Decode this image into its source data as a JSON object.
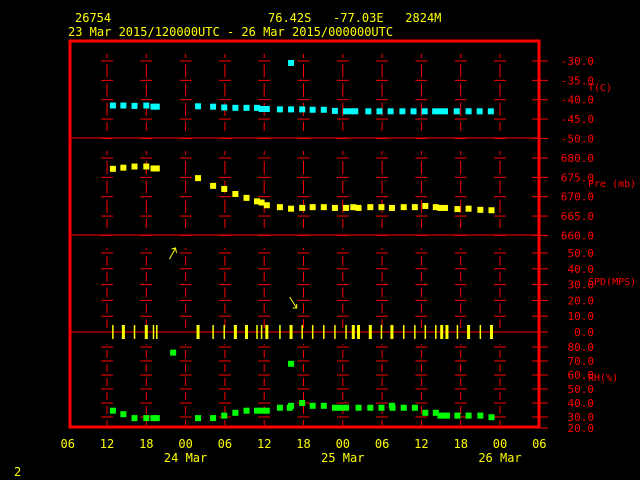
{
  "header": {
    "station_id": "26754",
    "location": "76.42S   -77.03E   2824M",
    "period": "23 Mar 2015/120000UTC - 26 Mar 2015/000000UTC"
  },
  "page_number": "2",
  "colors": {
    "axis": "#ff0000",
    "text": "#ffff00",
    "temperature": "#00ffff",
    "pressure": "#ffff00",
    "wind": "#ffff00",
    "humidity": "#00ff00"
  },
  "chart_data": {
    "type": "scatter",
    "x_unit": "hours since 23 Mar 2015 12:00 UTC",
    "xlim": [
      -6,
      66
    ],
    "x_tick_labels": [
      "06",
      "12",
      "18",
      "00",
      "06",
      "12",
      "18",
      "00",
      "06",
      "12",
      "18",
      "00",
      "06"
    ],
    "x_tick_hours": [
      -6,
      0,
      6,
      12,
      18,
      24,
      30,
      36,
      42,
      48,
      54,
      60,
      66
    ],
    "date_labels": [
      {
        "label": "24 Mar",
        "hour": 12
      },
      {
        "label": "25 Mar",
        "hour": 36
      },
      {
        "label": "26 Mar",
        "hour": 60
      }
    ],
    "panels": [
      {
        "name": "temperature",
        "ylabel": "T(C)",
        "ylim": [
          -50,
          -25
        ],
        "y_ticks": [
          -30,
          -35,
          -40,
          -45,
          -50
        ],
        "y_tick_labels": [
          "-30.0",
          "-35.0",
          "-40.0",
          "-45.0",
          "-50.0"
        ],
        "x": [
          0.9,
          2.5,
          4.2,
          6.0,
          7.1,
          7.6,
          13.9,
          16.2,
          17.9,
          19.6,
          21.3,
          22.9,
          23.6,
          24.4,
          26.4,
          28.1,
          29.8,
          31.4,
          33.1,
          34.8,
          36.5,
          37.2,
          37.9,
          39.9,
          41.6,
          43.3,
          45.1,
          46.8,
          48.5,
          50.1,
          50.9,
          51.6,
          53.4,
          55.2,
          56.9,
          58.6,
          28.1
        ],
        "y": [
          -41.5,
          -41.5,
          -41.6,
          -41.5,
          -41.8,
          -41.8,
          -41.7,
          -41.8,
          -42.0,
          -42.1,
          -42.1,
          -42.1,
          -42.4,
          -42.4,
          -42.5,
          -42.5,
          -42.5,
          -42.6,
          -42.6,
          -42.9,
          -43.0,
          -43.0,
          -43.0,
          -43.0,
          -43.0,
          -43.0,
          -43.0,
          -43.0,
          -43.0,
          -43.0,
          -43.0,
          -43.0,
          -43.0,
          -43.0,
          -43.0,
          -43.0,
          -30.5
        ]
      },
      {
        "name": "pressure",
        "ylabel": "Pre (mb)",
        "ylim": [
          660,
          685
        ],
        "y_ticks": [
          680,
          675,
          670,
          665,
          660
        ],
        "y_tick_labels": [
          "680.0",
          "675.0",
          "670.0",
          "665.0",
          "660.0"
        ],
        "x": [
          0.9,
          2.5,
          4.2,
          6.0,
          7.1,
          7.6,
          13.9,
          16.2,
          17.9,
          19.6,
          21.3,
          22.9,
          23.6,
          24.4,
          26.4,
          28.1,
          29.8,
          31.4,
          33.1,
          34.8,
          36.5,
          37.6,
          38.4,
          40.2,
          41.9,
          43.5,
          45.3,
          47.0,
          48.6,
          50.2,
          50.9,
          51.6,
          53.5,
          55.2,
          57.0,
          58.7
        ],
        "y": [
          677.2,
          677.5,
          677.8,
          677.8,
          677.3,
          677.3,
          674.8,
          672.8,
          672.0,
          670.7,
          669.7,
          668.8,
          668.5,
          667.8,
          667.3,
          666.9,
          667.1,
          667.3,
          667.3,
          667.1,
          667.1,
          667.3,
          667.1,
          667.3,
          667.3,
          667.1,
          667.3,
          667.3,
          667.6,
          667.3,
          667.1,
          667.1,
          666.8,
          666.9,
          666.6,
          666.5
        ]
      },
      {
        "name": "wind_speed",
        "ylabel": "SPD(MPS)",
        "ylim": [
          0,
          55
        ],
        "y_ticks": [
          50,
          40,
          30,
          20,
          10,
          0
        ],
        "y_tick_labels": [
          "50.0",
          "40.0",
          "30.0",
          "20.0",
          "10.0",
          "0.0"
        ],
        "x": [
          0.9,
          2.5,
          4.2,
          6.0,
          7.1,
          7.6,
          13.9,
          16.2,
          17.9,
          19.6,
          21.3,
          22.9,
          23.6,
          24.4,
          26.4,
          28.1,
          29.8,
          31.4,
          33.1,
          34.8,
          36.5,
          37.6,
          38.4,
          40.2,
          41.9,
          43.5,
          45.3,
          47.0,
          48.6,
          50.2,
          51.1,
          51.9,
          53.5,
          55.2,
          57.0,
          58.7
        ],
        "y": [
          3,
          4,
          3,
          4,
          3,
          3,
          4,
          3,
          3,
          4,
          4,
          3,
          3,
          4,
          3,
          4,
          3,
          3,
          3,
          3,
          3,
          4,
          4,
          4,
          3,
          4,
          3,
          3,
          3,
          3,
          4,
          4,
          3,
          4,
          3,
          4
        ],
        "direction_arrows": [
          {
            "hour": 10.0,
            "direction": "up-right"
          },
          {
            "hour": 28.5,
            "direction": "down-right"
          }
        ]
      },
      {
        "name": "relative_humidity",
        "ylabel": "RH(%)",
        "ylim": [
          20,
          90
        ],
        "y_ticks": [
          80,
          70,
          60,
          50,
          40,
          30,
          20
        ],
        "y_tick_labels": [
          "80.0",
          "70.0",
          "60.0",
          "50.0",
          "40.0",
          "30.0",
          "20.0"
        ],
        "x": [
          0.9,
          2.5,
          4.2,
          6.0,
          7.1,
          7.6,
          10.1,
          13.9,
          16.2,
          17.9,
          19.6,
          21.3,
          22.9,
          23.6,
          24.4,
          26.4,
          27.9,
          28.1,
          28.1,
          29.8,
          31.4,
          33.1,
          34.8,
          35.6,
          36.5,
          38.4,
          40.2,
          41.9,
          43.5,
          43.6,
          45.3,
          47.0,
          48.6,
          50.2,
          50.9,
          51.3,
          51.9,
          53.5,
          55.2,
          57.0,
          58.7
        ],
        "y": [
          34.5,
          32,
          29,
          29,
          29,
          29,
          76,
          29,
          29,
          31,
          33,
          34.5,
          34.5,
          34.5,
          34.5,
          36.6,
          36.6,
          38,
          68,
          40,
          38,
          38,
          36.6,
          36.6,
          36.6,
          36.6,
          36.6,
          36.6,
          38,
          36.6,
          36.6,
          36.6,
          33,
          33,
          31,
          31,
          31,
          31,
          31,
          31,
          29.8
        ]
      }
    ]
  }
}
